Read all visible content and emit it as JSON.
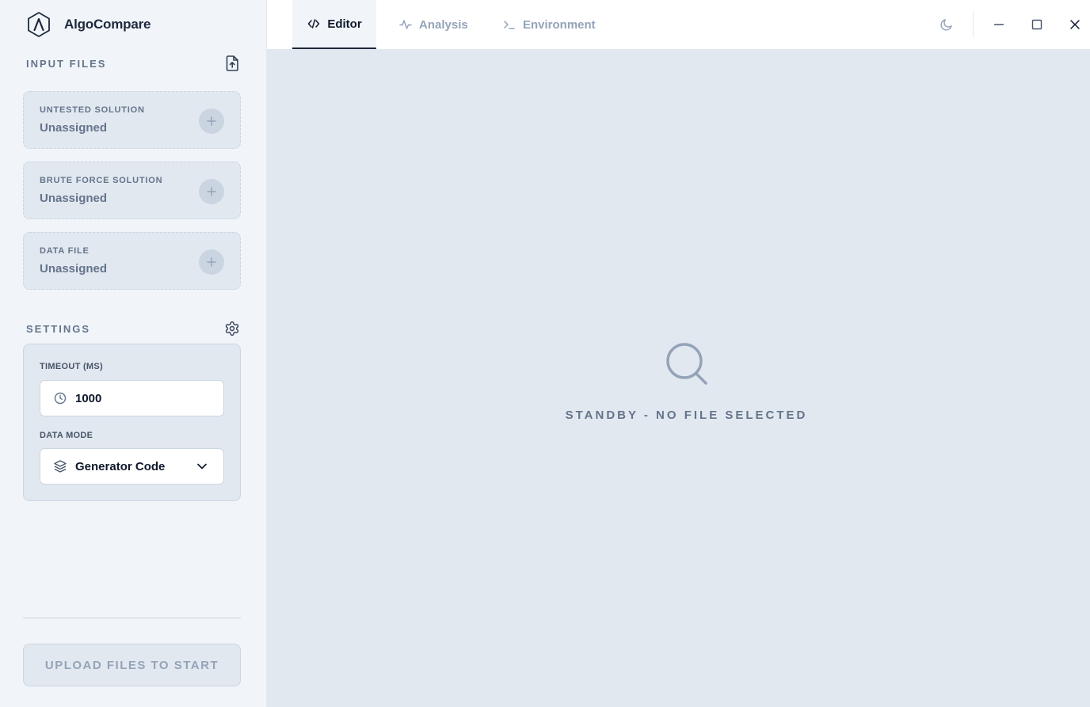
{
  "app": {
    "name": "AlgoCompare"
  },
  "sidebar": {
    "input_files": {
      "title": "INPUT FILES",
      "upload_icon": "file-upload-icon",
      "files": [
        {
          "label": "UNTESTED SOLUTION",
          "value": "Unassigned"
        },
        {
          "label": "BRUTE FORCE SOLUTION",
          "value": "Unassigned"
        },
        {
          "label": "DATA FILE",
          "value": "Unassigned"
        }
      ]
    },
    "settings": {
      "title": "SETTINGS",
      "timeout": {
        "label": "TIMEOUT (MS)",
        "value": "1000",
        "icon": "clock-icon"
      },
      "data_mode": {
        "label": "DATA MODE",
        "value": "Generator Code",
        "icon": "layers-icon"
      }
    },
    "start_button": "UPLOAD FILES TO START"
  },
  "tabs": [
    {
      "label": "Editor",
      "icon": "code-icon",
      "active": true
    },
    {
      "label": "Analysis",
      "icon": "activity-icon",
      "active": false
    },
    {
      "label": "Environment",
      "icon": "terminal-icon",
      "active": false
    }
  ],
  "main": {
    "status_text": "STANDBY - NO FILE SELECTED",
    "status_icon": "search-icon"
  },
  "colors": {
    "sidebar_bg": "#f1f5f9",
    "main_bg": "#e2e8f0",
    "text_dark": "#0f172a",
    "text_muted": "#64748b"
  }
}
